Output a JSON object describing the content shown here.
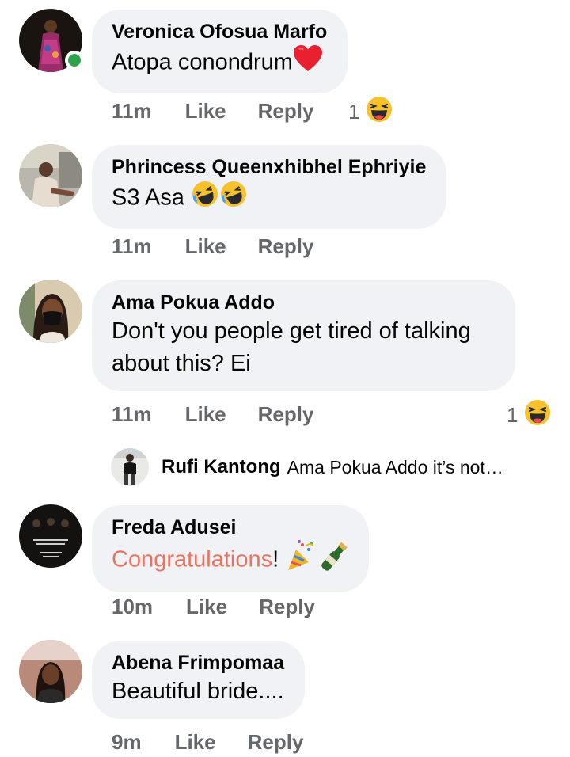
{
  "comments": [
    {
      "author": "Veronica Ofosua Marfo",
      "text": "Atopa conondrum",
      "time": "11m",
      "like": "Like",
      "reply": "Reply",
      "reaction_count": "1",
      "reaction_icon": "haha-icon",
      "text_icon": "red-heart-icon",
      "online": true
    },
    {
      "author": "Phrincess Queenxhibhel Ephriyie",
      "text": "S3 Asa",
      "time": "11m",
      "like": "Like",
      "reply": "Reply",
      "text_icon": "rolling-laugh-icon"
    },
    {
      "author": "Ama Pokua Addo",
      "text_line1": "Don't you people get tired of talking",
      "text_line2": "about this? Ei",
      "time": "11m",
      "like": "Like",
      "reply": "Reply",
      "reaction_count": "1",
      "reaction_icon": "haha-icon",
      "reply_preview": {
        "author": "Rufi Kantong",
        "text": "Ama Pokua Addo it’s not…"
      }
    },
    {
      "author": "Freda Adusei",
      "text_highlight": "Congratulations",
      "text_after": "!",
      "time": "10m",
      "like": "Like",
      "reply": "Reply",
      "text_icon": "party-popper-and-champagne-icon"
    },
    {
      "author": "Abena Frimpomaa",
      "text": "Beautiful bride....",
      "time": "9m",
      "like": "Like",
      "reply": "Reply"
    }
  ],
  "colors": {
    "bubble": "#f0f2f5",
    "meta": "#65676b",
    "highlight": "#e9735f",
    "online": "#31a24c"
  }
}
